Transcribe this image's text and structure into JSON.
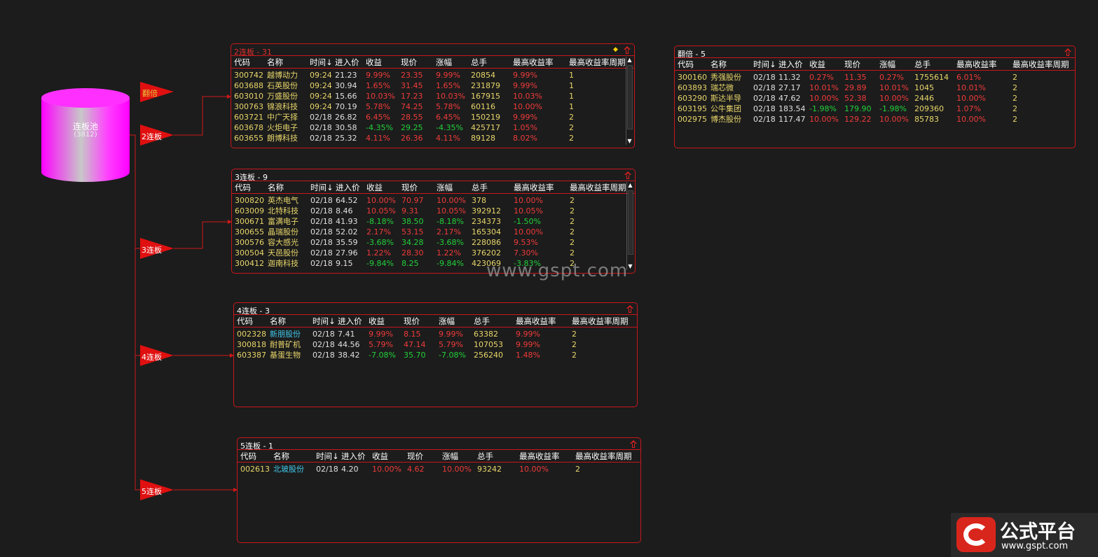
{
  "pool": {
    "title": "连板池",
    "count": "(3812)"
  },
  "arrows": [
    {
      "label": "翻倍",
      "highlight": true
    },
    {
      "label": "2连板",
      "highlight": false
    },
    {
      "label": "3连板",
      "highlight": false
    },
    {
      "label": "4连板",
      "highlight": false
    },
    {
      "label": "5连板",
      "highlight": false
    }
  ],
  "columns": [
    "代码",
    "名称",
    "时间↓",
    "进入价",
    "收益",
    "现价",
    "涨幅",
    "总手",
    "最高收益率",
    "最高收益率周期"
  ],
  "panels": {
    "p2": {
      "title": "2连板 - 31",
      "rows": [
        [
          "300742",
          "越博动力",
          "09:24",
          "21.23",
          "9.99%",
          "23.35",
          "9.99%",
          "20854",
          "9.99%",
          "1"
        ],
        [
          "603688",
          "石英股份",
          "09:24",
          "30.94",
          "1.65%",
          "31.45",
          "1.65%",
          "231879",
          "9.99%",
          "1"
        ],
        [
          "603010",
          "万盛股份",
          "09:24",
          "15.66",
          "10.03%",
          "17.23",
          "10.03%",
          "167915",
          "10.03%",
          "1"
        ],
        [
          "300763",
          "锦浪科技",
          "09:24",
          "70.19",
          "5.78%",
          "74.25",
          "5.78%",
          "60116",
          "10.00%",
          "1"
        ],
        [
          "603721",
          "中广天择",
          "02/18",
          "26.82",
          "6.45%",
          "28.55",
          "6.45%",
          "150219",
          "9.99%",
          "2"
        ],
        [
          "603678",
          "火炬电子",
          "02/18",
          "30.58",
          "-4.35%",
          "29.25",
          "-4.35%",
          "425717",
          "1.05%",
          "2"
        ],
        [
          "603655",
          "朗博科技",
          "02/18",
          "25.32",
          "4.11%",
          "26.36",
          "4.11%",
          "89128",
          "8.02%",
          "2"
        ]
      ]
    },
    "p3": {
      "title": "3连板 - 9",
      "rows": [
        [
          "300820",
          "英杰电气",
          "02/18",
          "64.52",
          "10.00%",
          "70.97",
          "10.00%",
          "378",
          "10.00%",
          "2"
        ],
        [
          "603009",
          "北特科技",
          "02/18",
          "8.46",
          "10.05%",
          "9.31",
          "10.05%",
          "392912",
          "10.05%",
          "2"
        ],
        [
          "300671",
          "富满电子",
          "02/18",
          "41.93",
          "-8.18%",
          "38.50",
          "-8.18%",
          "234373",
          "-1.50%",
          "2"
        ],
        [
          "300655",
          "晶瑞股份",
          "02/18",
          "52.02",
          "2.17%",
          "53.15",
          "2.17%",
          "165304",
          "10.00%",
          "2"
        ],
        [
          "300576",
          "容大感光",
          "02/18",
          "35.59",
          "-3.68%",
          "34.28",
          "-3.68%",
          "228086",
          "9.53%",
          "2"
        ],
        [
          "300504",
          "天邑股份",
          "02/18",
          "27.96",
          "1.22%",
          "28.30",
          "1.22%",
          "376202",
          "7.30%",
          "2"
        ],
        [
          "300412",
          "迦南科技",
          "02/18",
          "9.15",
          "-9.84%",
          "8.25",
          "-9.84%",
          "423069",
          "-3.83%",
          "2"
        ]
      ]
    },
    "p4": {
      "title": "4连板 - 3",
      "rows": [
        [
          "002328",
          "新朋股份",
          "02/18",
          "7.41",
          "9.99%",
          "8.15",
          "9.99%",
          "63382",
          "9.99%",
          "2"
        ],
        [
          "300818",
          "耐普矿机",
          "02/18",
          "44.56",
          "5.79%",
          "47.14",
          "5.79%",
          "107053",
          "9.99%",
          "2"
        ],
        [
          "603387",
          "基蛋生物",
          "02/18",
          "38.42",
          "-7.08%",
          "35.70",
          "-7.08%",
          "256240",
          "1.48%",
          "2"
        ]
      ]
    },
    "p5": {
      "title": "5连板 - 1",
      "rows": [
        [
          "002613",
          "北玻股份",
          "02/18",
          "4.20",
          "10.00%",
          "4.62",
          "10.00%",
          "93242",
          "10.00%",
          "2"
        ]
      ]
    },
    "pf": {
      "title": "翻倍 - 5",
      "rows": [
        [
          "300160",
          "秀强股份",
          "02/18",
          "11.32",
          "0.27%",
          "11.35",
          "0.27%",
          "1755614",
          "6.01%",
          "2"
        ],
        [
          "603893",
          "瑞芯微",
          "02/18",
          "27.17",
          "10.01%",
          "29.89",
          "10.01%",
          "1045",
          "10.01%",
          "2"
        ],
        [
          "603290",
          "斯达半导",
          "02/18",
          "47.62",
          "10.00%",
          "52.38",
          "10.00%",
          "2446",
          "10.00%",
          "2"
        ],
        [
          "603195",
          "公牛集团",
          "02/18",
          "183.54",
          "-1.98%",
          "179.90",
          "-1.98%",
          "209360",
          "1.07%",
          "2"
        ],
        [
          "002975",
          "博杰股份",
          "02/18",
          "117.47",
          "10.00%",
          "129.22",
          "10.00%",
          "85783",
          "10.00%",
          "2"
        ]
      ]
    }
  },
  "watermark": "www.gspt.com",
  "logo": {
    "title": "公式平台",
    "url": "www.gspt.com"
  },
  "colors": {
    "border": "#c8161c",
    "up": "#f03a3a",
    "down": "#22d13a",
    "code": "#e8d66a",
    "cyan_name": "#3fc6e8",
    "pool": "#ff00ff"
  }
}
